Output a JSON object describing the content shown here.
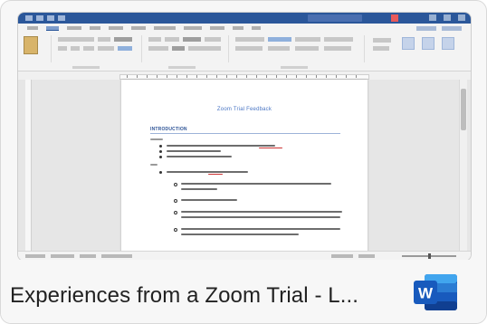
{
  "card": {
    "file_name": "Experiences from a Zoom Trial - L...",
    "app_icon": "word-icon",
    "app_icon_letter": "W"
  },
  "document": {
    "title": "Zoom Trial Feedback",
    "heading": "INTRODUCTION"
  },
  "colors": {
    "word_blue": "#2b579a",
    "word_icon_dark": "#185abd",
    "word_icon_light": "#41a5ee",
    "card_background": "#f7f7f7"
  }
}
